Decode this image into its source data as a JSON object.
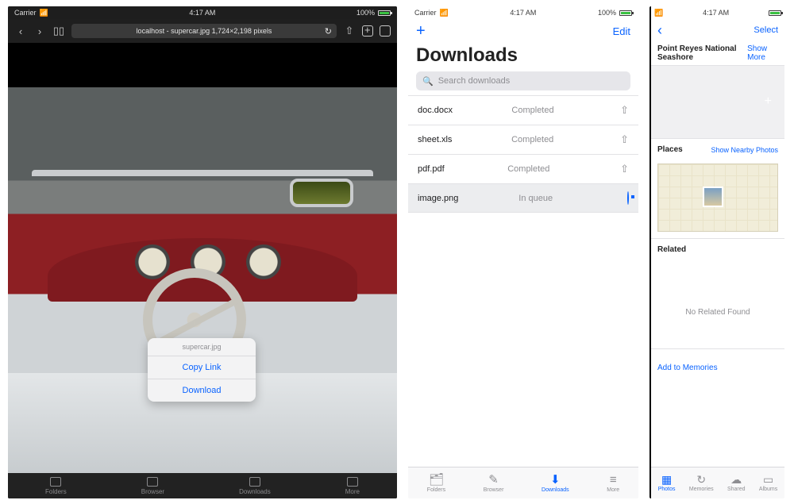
{
  "status": {
    "carrier": "Carrier",
    "wifi": "▾",
    "time": "4:17 AM",
    "battery": "100%"
  },
  "browser": {
    "url_label": "localhost - supercar.jpg 1,724×2,198 pixels",
    "context_header": "supercar.jpg",
    "context_items": [
      "Copy Link",
      "Download"
    ],
    "tabs": [
      "Folders",
      "Browser",
      "Downloads",
      "More"
    ]
  },
  "downloads": {
    "add_label": "+",
    "edit_label": "Edit",
    "title": "Downloads",
    "search_placeholder": "Search downloads",
    "rows": [
      {
        "name": "doc.docx",
        "status": "Completed",
        "action": "share"
      },
      {
        "name": "sheet.xls",
        "status": "Completed",
        "action": "share"
      },
      {
        "name": "pdf.pdf",
        "status": "Completed",
        "action": "share"
      },
      {
        "name": "image.png",
        "status": "In queue",
        "action": "progress",
        "selected": true
      }
    ],
    "tabs": [
      "Folders",
      "Browser",
      "Downloads",
      "More"
    ],
    "active_tab": 2
  },
  "photos": {
    "back": "‹",
    "select": "Select",
    "title": "Point Reyes National Seashore",
    "show_more": "Show More",
    "places_label": "Places",
    "nearby_link": "Show Nearby Photos",
    "related_label": "Related",
    "no_related": "No Related Found",
    "add_memories": "Add to Memories",
    "tabs": [
      "Photos",
      "Memories",
      "Shared",
      "Albums"
    ],
    "active_tab": 0
  }
}
